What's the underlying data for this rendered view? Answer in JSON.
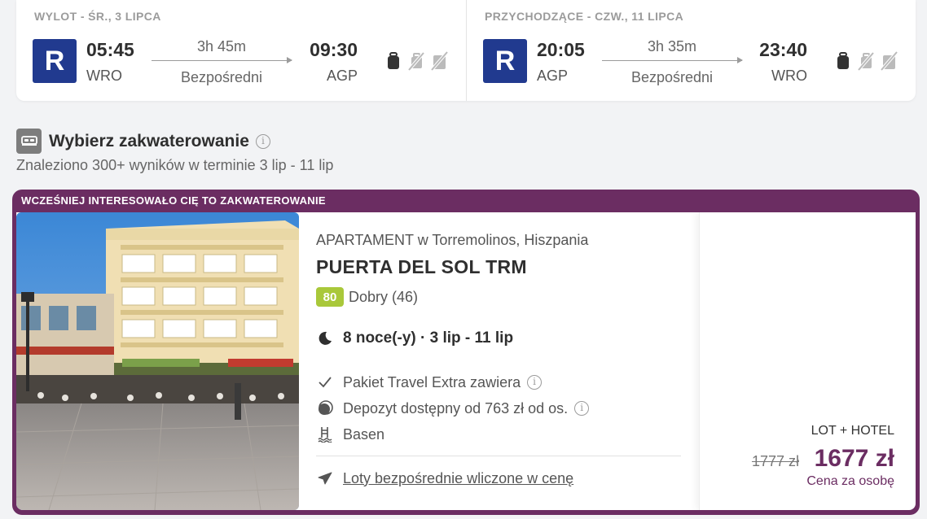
{
  "outbound": {
    "header": "WYLOT - ŚR., 3 LIPCA",
    "airline_letter": "R",
    "dep_time": "05:45",
    "dep_code": "WRO",
    "duration": "3h 45m",
    "stops": "Bezpośredni",
    "arr_time": "09:30",
    "arr_code": "AGP"
  },
  "inbound": {
    "header": "PRZYCHODZĄCE - CZW., 11 LIPCA",
    "airline_letter": "R",
    "dep_time": "20:05",
    "dep_code": "AGP",
    "duration": "3h 35m",
    "stops": "Bezpośredni",
    "arr_time": "23:40",
    "arr_code": "WRO"
  },
  "baggage_icons": [
    "personal-bag-icon",
    "no-cabin-bag-icon",
    "no-checked-bag-icon"
  ],
  "accommodation": {
    "title": "Wybierz zakwaterowanie",
    "info_glyph": "i",
    "subtitle": "Znaleziono 300+ wyników w terminie 3 lip - 11 lip"
  },
  "offer": {
    "banner": "WCZEŚNIEJ INTERESOWAŁO CIĘ TO ZAKWATEROWANIE",
    "type_location": "APARTAMENT w Torremolinos, Hiszpania",
    "name": "PUERTA DEL SOL TRM",
    "score": "80",
    "rating_text": "Dobry (46)",
    "stay": "8 noce(-y) · 3 lip - 11 lip",
    "feature_package": "Pakiet Travel Extra zawiera",
    "feature_deposit": "Depozyt dostępny od 763 zł od os.",
    "feature_pool": "Basen",
    "flights_included": "Loty bezpośrednie wliczone w cenę",
    "package_type": "LOT + HOTEL",
    "old_price": "1777 zł",
    "price": "1677 zł",
    "price_note": "Cena za osobę"
  },
  "colors": {
    "accent": "#6b2d62",
    "airline": "#213a8f",
    "score": "#a9c83a"
  }
}
